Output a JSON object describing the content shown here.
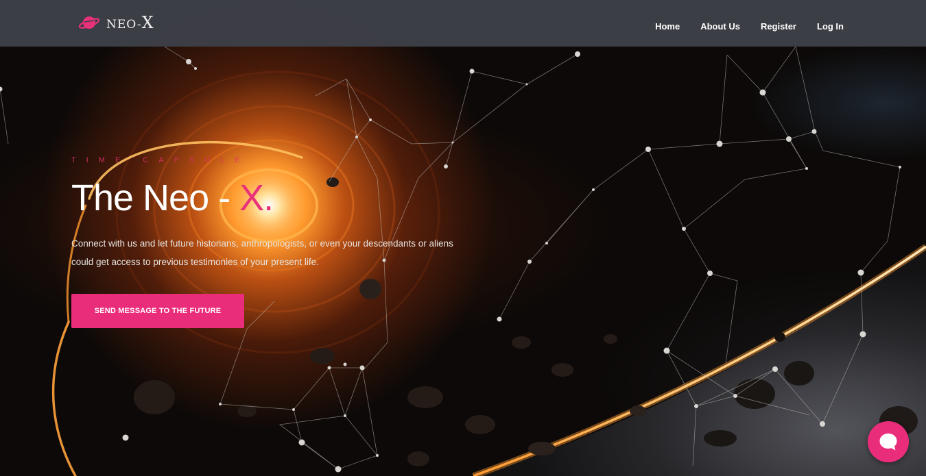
{
  "brand": {
    "logo_text": "NEO-",
    "logo_text_big": "X",
    "accent_color": "#ea2d7b",
    "header_color": "#3e4047"
  },
  "nav": {
    "home": "Home",
    "about": "About Us",
    "register": "Register",
    "login": "Log In"
  },
  "hero": {
    "eyebrow": "Time Capsule",
    "title_main": "The Neo - ",
    "title_accent": "X.",
    "description": "Connect with us and let future historians, anthropologists, or even your descendants or aliens could get access to previous testimonies of your present life.",
    "cta_label": "Send message to the future"
  },
  "chat_widget": {
    "icon": "chat-bubble-icon"
  }
}
